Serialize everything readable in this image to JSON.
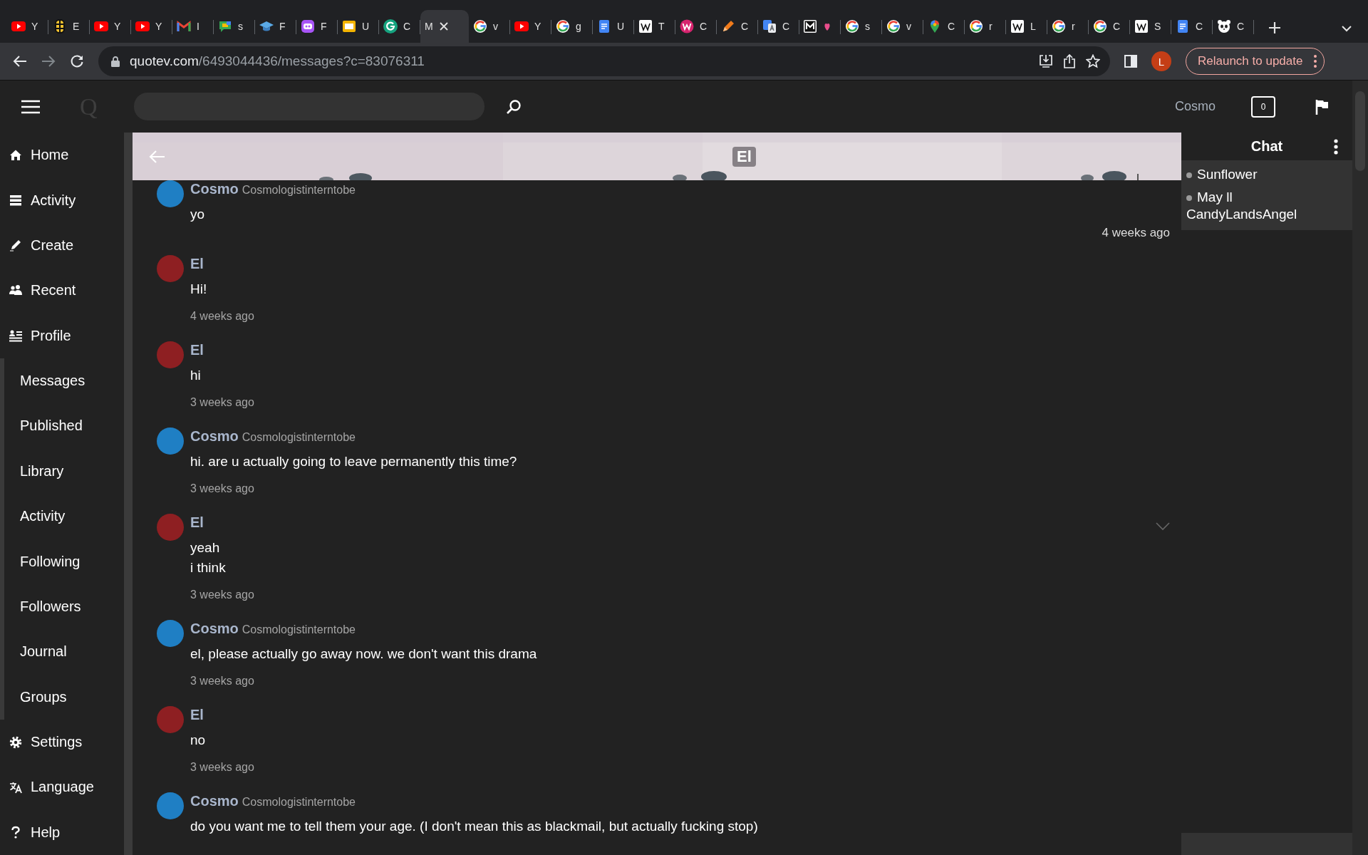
{
  "browser": {
    "tabs": [
      {
        "title": "Y",
        "kind": "play",
        "selected": false
      },
      {
        "title": "E",
        "kind": "stack",
        "selected": false
      },
      {
        "title": "Y",
        "kind": "play",
        "selected": false
      },
      {
        "title": "Y",
        "kind": "play",
        "selected": false
      },
      {
        "title": "I",
        "kind": "mail",
        "selected": false
      },
      {
        "title": "s",
        "kind": "chat",
        "selected": false
      },
      {
        "title": "F",
        "kind": "cap",
        "selected": false
      },
      {
        "title": "F",
        "kind": "robot",
        "selected": false
      },
      {
        "title": "U",
        "kind": "slides",
        "selected": false
      },
      {
        "title": "C",
        "kind": "gcircle",
        "selected": false
      },
      {
        "title": "M",
        "kind": "none",
        "selected": true
      },
      {
        "title": "v",
        "kind": "ring",
        "selected": false
      },
      {
        "title": "Y",
        "kind": "play",
        "selected": false
      },
      {
        "title": "g",
        "kind": "ring",
        "selected": false
      },
      {
        "title": "U",
        "kind": "doc",
        "selected": false
      },
      {
        "title": "T",
        "kind": "tile",
        "selected": false
      },
      {
        "title": "C",
        "kind": "roundtile",
        "selected": false
      },
      {
        "title": "C",
        "kind": "pencil",
        "selected": false
      },
      {
        "title": "C",
        "kind": "translate",
        "selected": false
      },
      {
        "kind": "squarelogo",
        "selected": false
      },
      {
        "title": "s",
        "kind": "ring",
        "selected": false
      },
      {
        "title": "v",
        "kind": "ring",
        "selected": false
      },
      {
        "title": "C",
        "kind": "pin",
        "selected": false
      },
      {
        "title": "r",
        "kind": "ring",
        "selected": false
      },
      {
        "title": "L",
        "kind": "tile",
        "selected": false
      },
      {
        "title": "r",
        "kind": "ring",
        "selected": false
      },
      {
        "title": "C",
        "kind": "ring",
        "selected": false
      },
      {
        "title": "S",
        "kind": "tile",
        "selected": false
      },
      {
        "title": "C",
        "kind": "doc",
        "selected": false
      },
      {
        "title": "C",
        "kind": "panda",
        "selected": false
      }
    ],
    "url": {
      "host": "quotev.com",
      "path": "/6493044436/messages?c=83076311"
    },
    "profile_initial": "L",
    "relaunch_button": "Relaunch to update"
  },
  "header": {
    "logo": "Q",
    "username": "Cosmo",
    "notification_count": "0"
  },
  "sidebar": {
    "items": [
      {
        "label": "Home",
        "kind": "home"
      },
      {
        "label": "Activity",
        "kind": "activity"
      },
      {
        "label": "Create",
        "kind": "create"
      },
      {
        "label": "Recent",
        "kind": "recent"
      },
      {
        "label": "Profile",
        "kind": "profile"
      },
      {
        "label": "Messages",
        "kind": "sub"
      },
      {
        "label": "Published",
        "kind": "sub"
      },
      {
        "label": "Library",
        "kind": "sub"
      },
      {
        "label": "Activity",
        "kind": "sub"
      },
      {
        "label": "Following",
        "kind": "sub"
      },
      {
        "label": "Followers",
        "kind": "sub"
      },
      {
        "label": "Journal",
        "kind": "sub"
      },
      {
        "label": "Groups",
        "kind": "sub"
      },
      {
        "label": "Settings",
        "kind": "settings"
      },
      {
        "label": "Language",
        "kind": "language"
      },
      {
        "label": "Help",
        "kind": "help"
      }
    ]
  },
  "conversation": {
    "title": "El",
    "messages": [
      {
        "author": "Cosmo",
        "handle": "Cosmologistinterntobe",
        "color": "#1f7fc4",
        "lines": [
          "yo"
        ],
        "time": "4 weeks ago",
        "kind": "time-right",
        "hovered": false
      },
      {
        "author": "El",
        "color": "#8e1f22",
        "lines": [
          "Hi!"
        ],
        "time": "4 weeks ago",
        "kind": "time-below",
        "hovered": false
      },
      {
        "author": "El",
        "color": "#8e1f22",
        "lines": [
          "hi"
        ],
        "time": "3 weeks ago",
        "kind": "time-below",
        "hovered": false
      },
      {
        "author": "Cosmo",
        "handle": "Cosmologistinterntobe",
        "color": "#1f7fc4",
        "lines": [
          "hi. are u actually going to leave permanently this time?"
        ],
        "time": "3 weeks ago",
        "kind": "time-below",
        "hovered": false
      },
      {
        "author": "El",
        "color": "#8e1f22",
        "lines": [
          "yeah",
          "i think"
        ],
        "time": "3 weeks ago",
        "kind": "time-below",
        "hovered": true
      },
      {
        "author": "Cosmo",
        "handle": "Cosmologistinterntobe",
        "color": "#1f7fc4",
        "lines": [
          "el, please actually go away now. we don't want this drama"
        ],
        "time": "3 weeks ago",
        "kind": "time-below",
        "hovered": false
      },
      {
        "author": "El",
        "color": "#8e1f22",
        "lines": [
          "no"
        ],
        "time": "3 weeks ago",
        "kind": "time-below",
        "hovered": false
      },
      {
        "author": "Cosmo",
        "handle": "Cosmologistinterntobe",
        "color": "#1f7fc4",
        "lines": [
          "do you want me to tell them your age. (I don't mean this as blackmail, but actually fucking stop)"
        ],
        "hovered": false
      }
    ]
  },
  "chat": {
    "title": "Chat",
    "contacts": [
      {
        "name": "Sunflower"
      },
      {
        "name": "May ll CandyLandsAngel"
      }
    ]
  }
}
